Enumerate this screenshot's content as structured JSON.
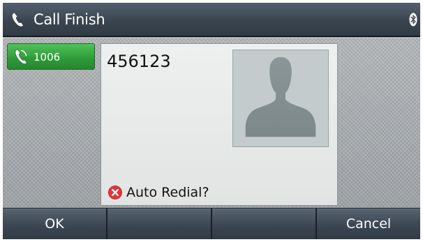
{
  "titlebar": {
    "title": "Call Finish",
    "icons": [
      "phone-handset-icon",
      "bluetooth-icon"
    ]
  },
  "line_key": {
    "label": "1006",
    "icon": "phone-handset-icon",
    "color": "#3bb046"
  },
  "call": {
    "number": "456123",
    "avatar_icon": "contact-silhouette-icon",
    "prompt": "Auto Redial?",
    "prompt_icon": "error-x-icon",
    "prompt_icon_color": "#e2343a"
  },
  "softkeys": [
    "OK",
    "",
    "",
    "Cancel"
  ]
}
